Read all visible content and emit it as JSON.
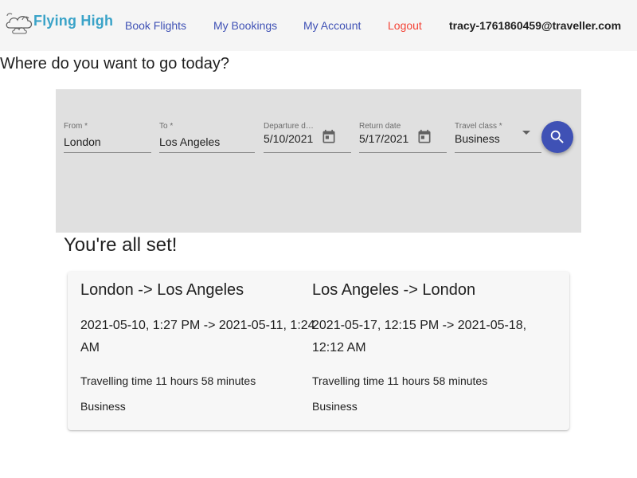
{
  "header": {
    "logo_text": "Flying High",
    "logo_icon": "cloud-icon",
    "nav": [
      {
        "label": "Book Flights"
      },
      {
        "label": "My Bookings"
      },
      {
        "label": "My Account"
      },
      {
        "label": "Logout"
      }
    ],
    "user_email": "tracy-1761860459@traveller.com",
    "colors": {
      "nav": "#3f51b5",
      "logout": "#f44336",
      "logo": "#3aa3c8"
    }
  },
  "question": "Where do you want to go today?",
  "search": {
    "from": {
      "label": "From *",
      "value": "London"
    },
    "to": {
      "label": "To *",
      "value": "Los Angeles"
    },
    "departure": {
      "label": "Departure date",
      "value": "5/10/2021",
      "icon": "calendar-icon"
    },
    "return": {
      "label": "Return date",
      "value": "5/17/2021",
      "icon": "calendar-icon"
    },
    "travel_class": {
      "label": "Travel class *",
      "value": "Business",
      "icon": "chevron-down-icon"
    },
    "search_icon": "search-icon",
    "colors": {
      "panel": "#e0e0e0",
      "fab": "#3f51b5"
    }
  },
  "confirmation": {
    "heading": "You're all set!",
    "legs": [
      {
        "route": "London -> Los Angeles",
        "times": "2021-05-10, 1:27 PM -> 2021-05-11, 1:24 AM",
        "duration": "Travelling time 11 hours 58 minutes",
        "class": "Business"
      },
      {
        "route": "Los Angeles -> London",
        "times": "2021-05-17, 12:15 PM -> 2021-05-18, 12:12 AM",
        "duration": "Travelling time 11 hours 58 minutes",
        "class": "Business"
      }
    ]
  }
}
